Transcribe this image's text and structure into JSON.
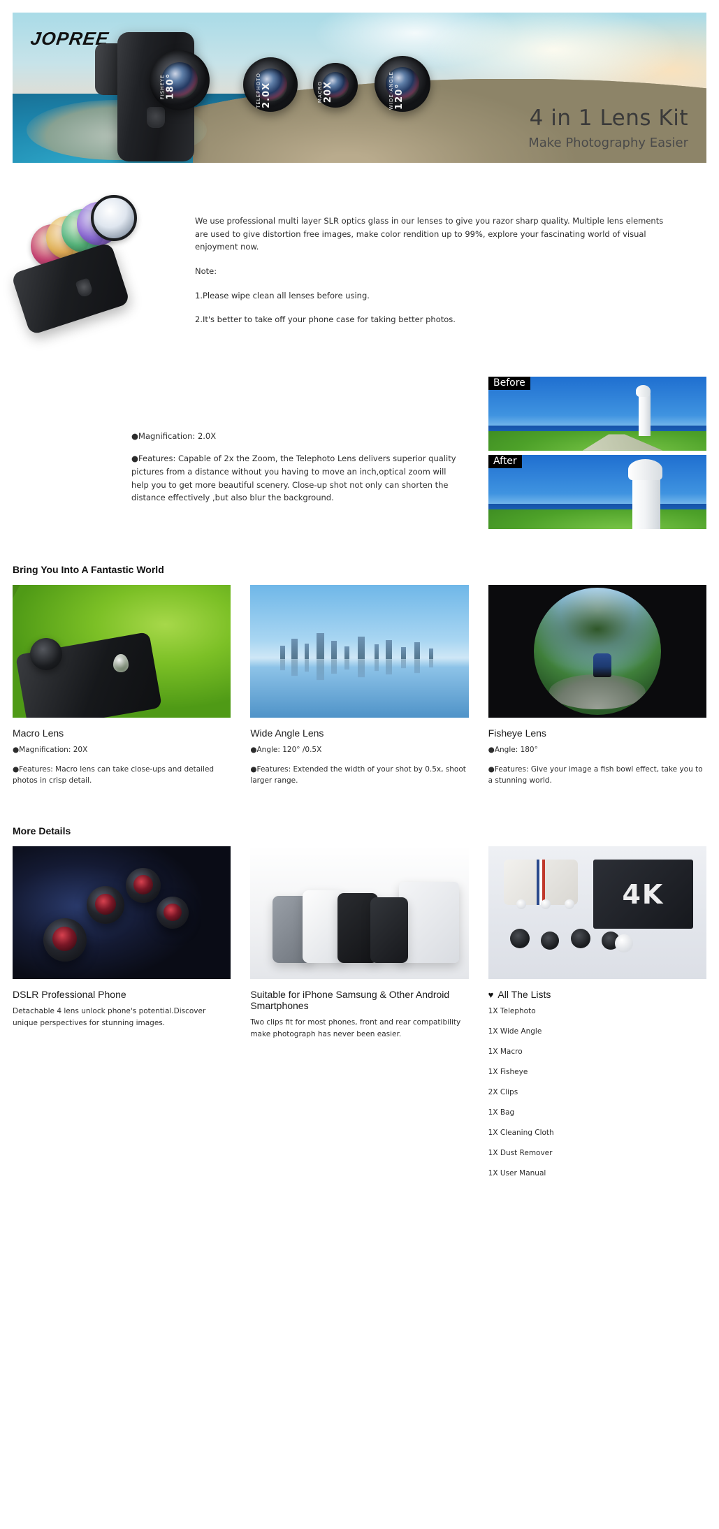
{
  "brand": {
    "logo": "JOPREE"
  },
  "hero": {
    "title": "4 in 1 Lens Kit",
    "subtitle": "Make Photography Easier",
    "lenses": [
      {
        "name": "fisheye",
        "type": "FISHEYE",
        "value": "180°"
      },
      {
        "name": "telephoto",
        "type": "TELEPHOTO",
        "value": "2.0X"
      },
      {
        "name": "macro",
        "type": "MACRO",
        "value": "20X"
      },
      {
        "name": "wide-angle",
        "type": "WIDE-ANGLE",
        "value": "120°"
      }
    ]
  },
  "intro": {
    "paragraph": "We use professional multi layer SLR optics glass in our lenses to give you razor sharp quality. Multiple lens elements are used to give distortion free images, make color rendition up to 99%, explore your fascinating world of visual enjoyment now.",
    "note_label": "Note:",
    "note_1": "1.Please wipe clean all lenses before using.",
    "note_2": "2.It's better to take off your phone case for taking better photos."
  },
  "telephoto": {
    "magnification": "●Magnification: 2.0X",
    "features": "●Features: Capable of 2x the Zoom, the Telephoto Lens delivers superior quality pictures from a distance without you having to move an inch,optical zoom will help you to get more beautiful scenery. Close-up shot not only can shorten the distance effectively ,but also blur the background.",
    "before_label": "Before",
    "after_label": "After"
  },
  "fantastic": {
    "heading": "Bring You Into A Fantastic World",
    "cards": [
      {
        "title": "Macro Lens",
        "spec": "●Magnification: 20X",
        "features": "●Features: Macro lens can take close-ups and detailed photos in crisp detail."
      },
      {
        "title": "Wide Angle Lens",
        "spec": "●Angle: 120° /0.5X",
        "features": "●Features: Extended the width of your shot by 0.5x, shoot larger range."
      },
      {
        "title": "Fisheye Lens",
        "spec": "●Angle: 180°",
        "features": "●Features: Give your image a fish bowl effect, take you to a stunning world."
      }
    ]
  },
  "more_details": {
    "heading": "More Details",
    "cards": [
      {
        "title": "DSLR Professional Phone",
        "body": "Detachable 4 lens unlock phone's potential.Discover unique perspectives for stunning images."
      },
      {
        "title": "Suitable for iPhone Samsung & Other Android Smartphones",
        "body": "Two clips fit for most phones, front and rear compatibility make photograph has never been easier."
      }
    ],
    "kit_box_text": "4K",
    "list": {
      "heart_icon": "♥",
      "title": "All The Lists",
      "items": [
        "1X Telephoto",
        "1X Wide Angle",
        "1X Macro",
        "1X Fisheye",
        "2X Clips",
        "1X Bag",
        "1X Cleaning Cloth",
        "1X Dust Remover",
        "1X User Manual"
      ]
    }
  }
}
